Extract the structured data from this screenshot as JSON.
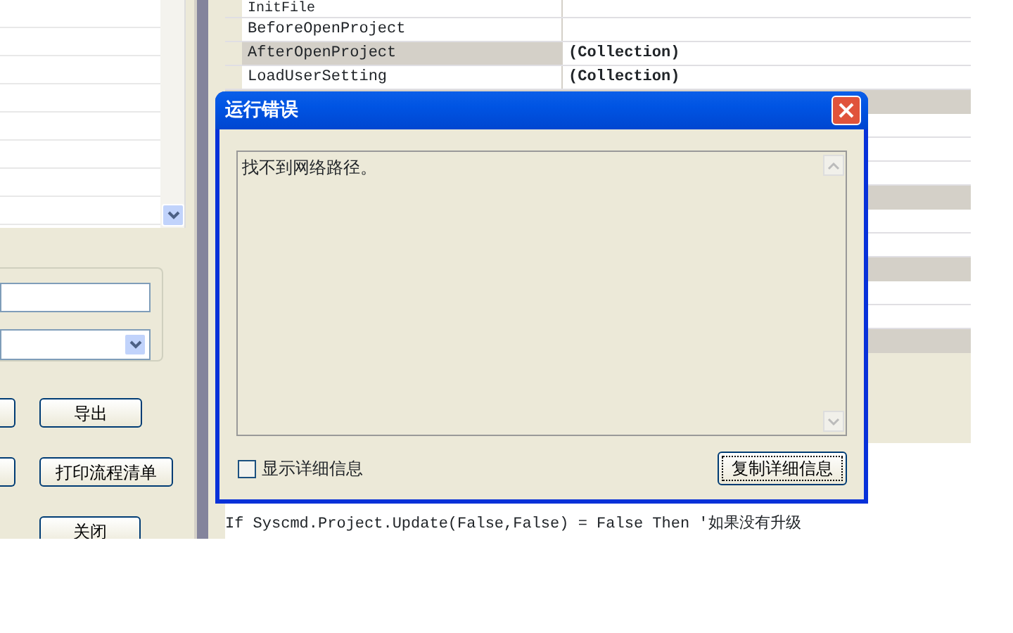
{
  "left_panel": {
    "buttons": [
      {
        "label": "导出"
      },
      {
        "label": "打印流程清单"
      },
      {
        "label": "关闭"
      }
    ]
  },
  "property_grid": {
    "rows": [
      {
        "name": "InitFile",
        "selected": false
      },
      {
        "name": "BeforeOpenProject",
        "selected": false
      },
      {
        "name": "AfterOpenProject",
        "value": "(Collection)",
        "selected": true
      },
      {
        "name": "LoadUserSetting",
        "value": "(Collection)",
        "selected": false
      }
    ]
  },
  "code_lines": [
    "If Syscmd.Project.Update(False,False) = False Then '如果没有升级"
  ],
  "dialog": {
    "title": "运行错误",
    "message": "找不到网络路径。",
    "show_details": {
      "label": "显示详细信息",
      "checked": false
    },
    "copy_button": "复制详细信息"
  }
}
